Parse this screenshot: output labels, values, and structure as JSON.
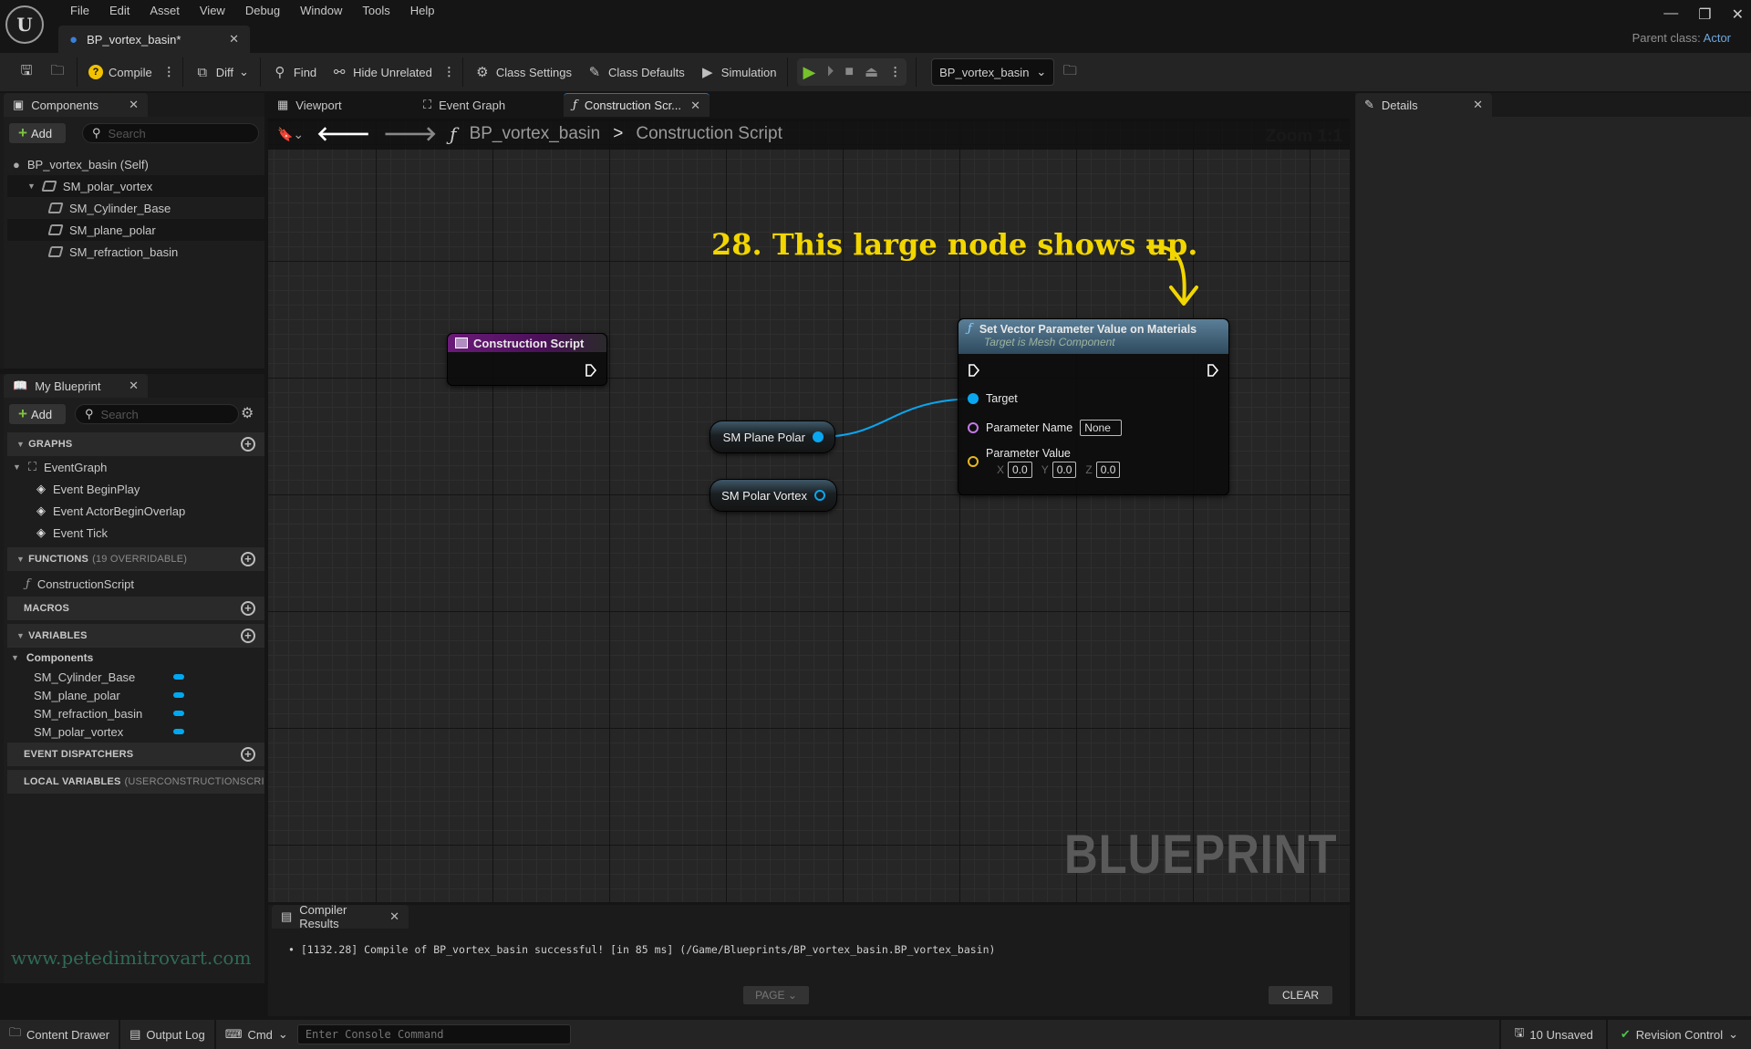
{
  "window": {
    "logo": "U",
    "menu": [
      "File",
      "Edit",
      "Asset",
      "View",
      "Debug",
      "Window",
      "Tools",
      "Help"
    ],
    "doc_tab": "BP_vortex_basin*",
    "parent_class_label": "Parent class:",
    "parent_class_value": "Actor",
    "controls": {
      "minimize": "—",
      "restore": "❐",
      "close": "✕"
    }
  },
  "toolbar": {
    "compile": "Compile",
    "diff": "Diff",
    "find": "Find",
    "hide_unrelated": "Hide Unrelated",
    "class_settings": "Class Settings",
    "class_defaults": "Class Defaults",
    "simulation": "Simulation",
    "debug_object": "BP_vortex_basin"
  },
  "components_panel": {
    "title": "Components",
    "add_label": "Add",
    "search_placeholder": "Search",
    "items": [
      {
        "label": "BP_vortex_basin (Self)",
        "level": 0
      },
      {
        "label": "SM_polar_vortex",
        "level": 1
      },
      {
        "label": "SM_Cylinder_Base",
        "level": 2
      },
      {
        "label": "SM_plane_polar",
        "level": 2
      },
      {
        "label": "SM_refraction_basin",
        "level": 2
      }
    ]
  },
  "my_blueprint": {
    "title": "My Blueprint",
    "add_label": "Add",
    "search_placeholder": "Search",
    "graphs_header": "GRAPHS",
    "event_graph": "EventGraph",
    "events": [
      "Event BeginPlay",
      "Event ActorBeginOverlap",
      "Event Tick"
    ],
    "functions_header": "FUNCTIONS",
    "functions_sub": "(19 OVERRIDABLE)",
    "functions": [
      "ConstructionScript"
    ],
    "macros_header": "MACROS",
    "variables_header": "VARIABLES",
    "components_category": "Components",
    "variables": [
      "SM_Cylinder_Base",
      "SM_plane_polar",
      "SM_refraction_basin",
      "SM_polar_vortex"
    ],
    "event_dispatchers_header": "EVENT DISPATCHERS",
    "local_variables_header": "LOCAL VARIABLES",
    "local_variables_sub": "(USERCONSTRUCTIONSCRI",
    "variable_color": "#00a8f0"
  },
  "graph_tabs": [
    {
      "label": "Viewport"
    },
    {
      "label": "Event Graph"
    },
    {
      "label": "Construction Scr...",
      "active": true
    }
  ],
  "breadcrumb": {
    "root": "BP_vortex_basin",
    "separator": ">",
    "current": "Construction Script"
  },
  "graph": {
    "zoom": "Zoom 1:1",
    "watermark": "BLUEPRINT",
    "annotation": "28. This large node shows up.",
    "annotation_color": "#f2d600",
    "construction_node": {
      "title": "Construction Script",
      "header_color": "#6a1a78"
    },
    "var_nodes": [
      {
        "label": "SM Plane Polar",
        "connected": true
      },
      {
        "label": "SM Polar Vortex",
        "connected": false
      }
    ],
    "function_node": {
      "title": "Set Vector Parameter Value on Materials",
      "subtitle": "Target is Mesh Component",
      "pins": {
        "target": "Target",
        "parameter_name": "Parameter Name",
        "parameter_name_value": "None",
        "parameter_value": "Parameter Value",
        "x_label": "X",
        "x": "0.0",
        "y_label": "Y",
        "y": "0.0",
        "z_label": "Z",
        "z": "0.0"
      },
      "pin_colors": {
        "object": "#0aa6f0",
        "name": "#c47ae8",
        "vector": "#e8b81c"
      }
    }
  },
  "details_panel": {
    "title": "Details"
  },
  "compiler_results": {
    "title": "Compiler Results",
    "message": "[1132.28] Compile of BP_vortex_basin successful! [in 85 ms] (/Game/Blueprints/BP_vortex_basin.BP_vortex_basin)",
    "page_label": "PAGE",
    "clear_label": "CLEAR"
  },
  "site_watermark": "www.petedimitrovart.com",
  "statusbar": {
    "content_drawer": "Content Drawer",
    "output_log": "Output Log",
    "cmd": "Cmd",
    "console_placeholder": "Enter Console Command",
    "unsaved": "10 Unsaved",
    "revision_control": "Revision Control"
  }
}
